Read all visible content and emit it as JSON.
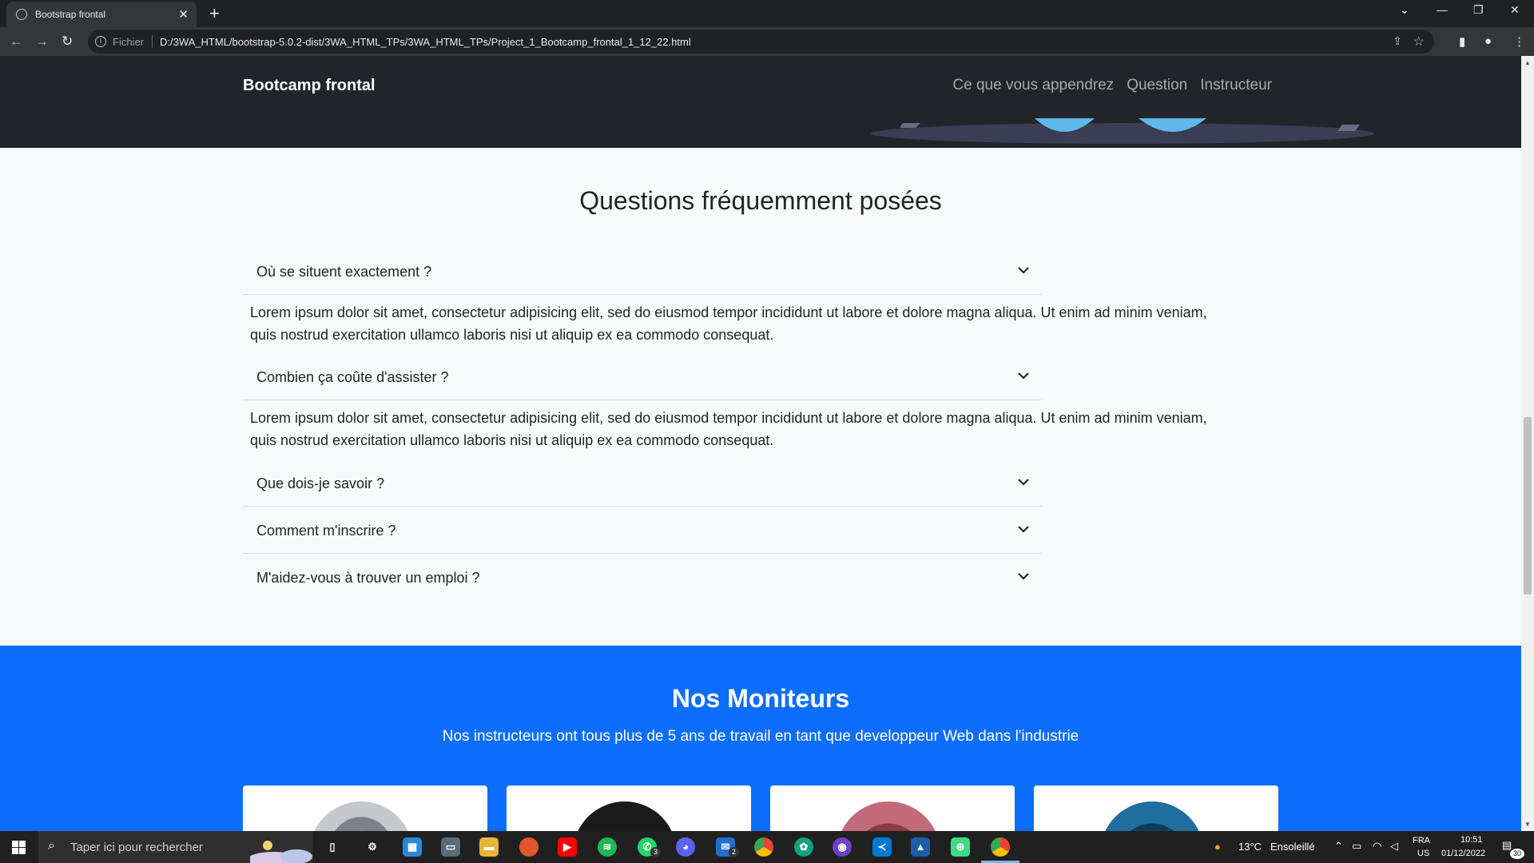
{
  "browser": {
    "tab_title": "Bootstrap frontal",
    "tab_close": "✕",
    "new_tab": "+",
    "window_controls": [
      "⌄",
      "—",
      "❐",
      "✕"
    ],
    "nav": {
      "back": "←",
      "forward": "→",
      "reload": "↻"
    },
    "address": {
      "scheme_label": "Fichier",
      "url": "D:/3WA_HTML/bootstrap-5.0.2-dist/3WA_HTML_TPs/3WA_HTML_TPs/Project_1_Bootcamp_frontal_1_12_22.html"
    }
  },
  "page": {
    "navbar": {
      "brand": "Bootcamp frontal",
      "links": [
        "Ce que vous appendrez",
        "Question",
        "Instructeur"
      ]
    },
    "faq": {
      "title": "Questions fréquemment posées",
      "items": [
        {
          "question": "Où se situent exactement ?",
          "expanded": true,
          "answer": "Lorem ipsum dolor sit amet, consectetur adipisicing elit, sed do eiusmod tempor incididunt ut labore et dolore magna aliqua. Ut enim ad minim veniam, quis nostrud exercitation ullamco laboris nisi ut aliquip ex ea commodo consequat."
        },
        {
          "question": "Combien ça coûte d'assister ?",
          "expanded": true,
          "answer": "Lorem ipsum dolor sit amet, consectetur adipisicing elit, sed do eiusmod tempor incididunt ut labore et dolore magna aliqua. Ut enim ad minim veniam, quis nostrud exercitation ullamco laboris nisi ut aliquip ex ea commodo consequat."
        },
        {
          "question": "Que dois-je savoir ?",
          "expanded": false
        },
        {
          "question": "Comment m'inscrire ?",
          "expanded": false
        },
        {
          "question": "M'aidez-vous à trouver un emploi ?",
          "expanded": false
        }
      ]
    },
    "monitors": {
      "title": "Nos Moniteurs",
      "subtitle": "Nos instructeurs ont tous plus de 5 ans de travail en tant que developpeur Web dans l'industrie",
      "card_count": 4
    }
  },
  "taskbar": {
    "search_placeholder": "Taper ici pour rechercher",
    "apps": [
      "task-view",
      "settings",
      "store",
      "photos",
      "file-explorer",
      "firefox",
      "youtube",
      "spotify",
      "whatsapp",
      "discord",
      "mail",
      "chrome",
      "chatgpt",
      "github",
      "vscode",
      "photos-app",
      "android-tool",
      "chrome-active"
    ],
    "badges": {
      "whatsapp": "3",
      "mail": "2"
    },
    "weather": {
      "temp": "13°C",
      "condition": "Ensoleillé"
    },
    "language": {
      "lang": "FRA",
      "region": "US"
    },
    "clock": {
      "time": "10:51",
      "date": "01/12/2022"
    },
    "notifications": "30"
  },
  "colors": {
    "navbar_bg": "#212529",
    "page_bg": "#f8f9fa",
    "primary": "#0d6efd",
    "chrome_dark": "#202124",
    "taskbar": "#202020"
  }
}
